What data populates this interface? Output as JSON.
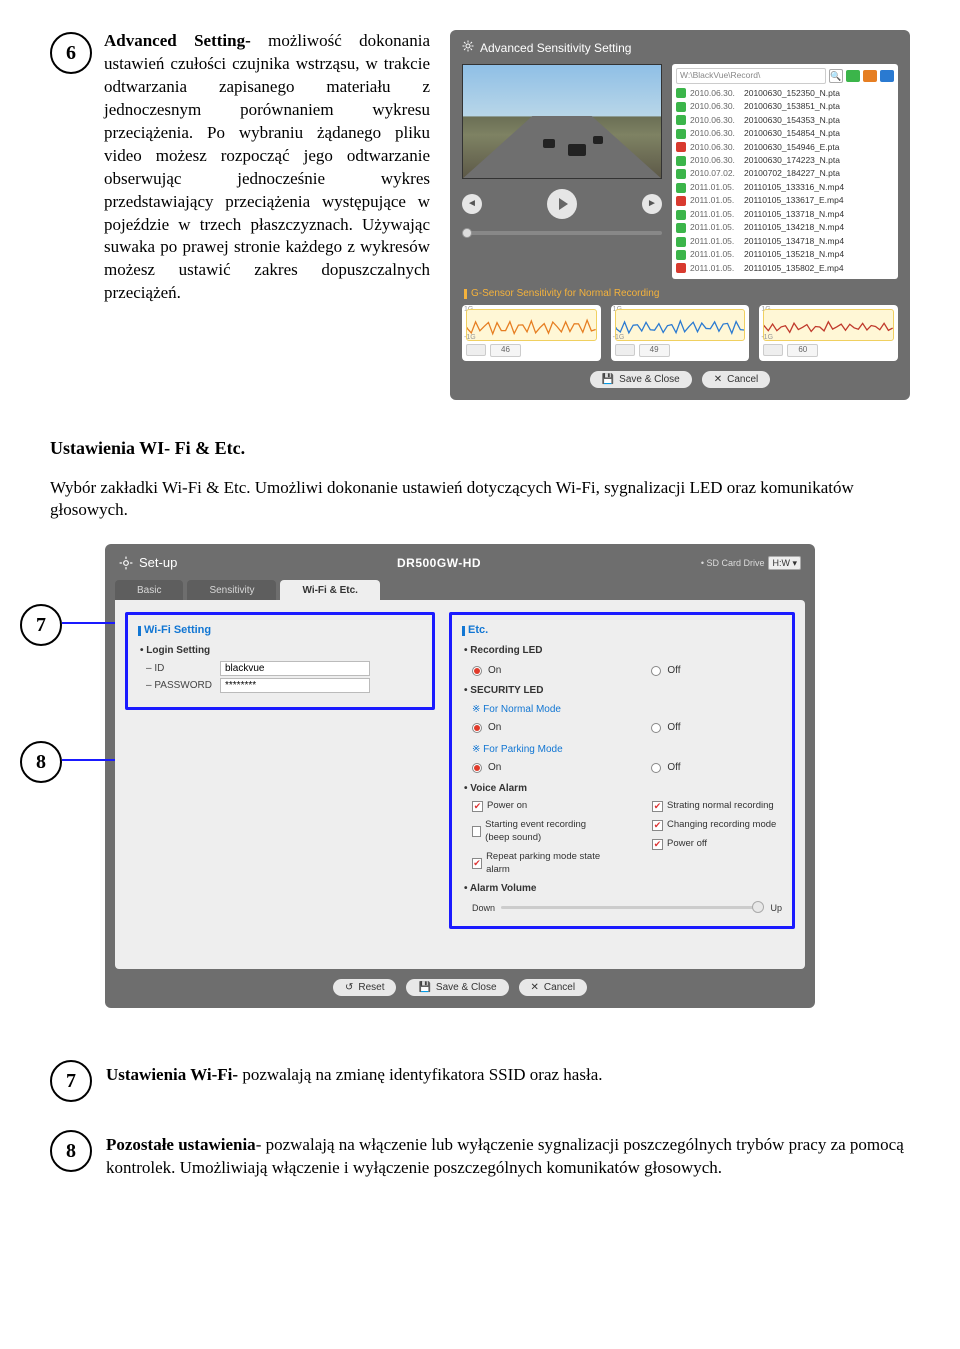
{
  "item6": {
    "num": "6",
    "text": "Advanced Setting- możliwość dokonania ustawień czułości czujnika wstrząsu, w trakcie odtwarzania zapisanego materiału z jednoczesnym porównaniem wykresu przeciążenia. Po wybraniu żądanego pliku video możesz rozpocząć jego odtwarzanie obserwując jednocześnie wykres przedstawiający przeciążenia występujące w pojeździe w trzech płaszczyznach. Używając suwaka po prawej stronie każdego z wykresów możesz ustawić zakres dopuszczalnych przeciążeń.",
    "bold_lead": "Advanced Setting-"
  },
  "sens_panel": {
    "title": "Advanced Sensitivity Setting",
    "files_path": "W:\\BlackVue\\Record\\",
    "files": [
      {
        "date": "2010.06.30.",
        "name": "20100630_152350_N.pta",
        "c": "#3bb54a"
      },
      {
        "date": "2010.06.30.",
        "name": "20100630_153851_N.pta",
        "c": "#3bb54a"
      },
      {
        "date": "2010.06.30.",
        "name": "20100630_154353_N.pta",
        "c": "#3bb54a"
      },
      {
        "date": "2010.06.30.",
        "name": "20100630_154854_N.pta",
        "c": "#3bb54a"
      },
      {
        "date": "2010.06.30.",
        "name": "20100630_154946_E.pta",
        "c": "#d83a2f"
      },
      {
        "date": "2010.06.30.",
        "name": "20100630_174223_N.pta",
        "c": "#3bb54a"
      },
      {
        "date": "2010.07.02.",
        "name": "20100702_184227_N.pta",
        "c": "#3bb54a"
      },
      {
        "date": "2011.01.05.",
        "name": "20110105_133316_N.mp4",
        "c": "#3bb54a"
      },
      {
        "date": "2011.01.05.",
        "name": "20110105_133617_E.mp4",
        "c": "#d83a2f"
      },
      {
        "date": "2011.01.05.",
        "name": "20110105_133718_N.mp4",
        "c": "#3bb54a"
      },
      {
        "date": "2011.01.05.",
        "name": "20110105_134218_N.mp4",
        "c": "#3bb54a"
      },
      {
        "date": "2011.01.05.",
        "name": "20110105_134718_N.mp4",
        "c": "#3bb54a"
      },
      {
        "date": "2011.01.05.",
        "name": "20110105_135218_N.mp4",
        "c": "#3bb54a"
      },
      {
        "date": "2011.01.05.",
        "name": "20110105_135802_E.mp4",
        "c": "#d83a2f"
      }
    ],
    "sens_label": "G-Sensor Sensitivity for Normal Recording",
    "scale_top": "1G",
    "scale_bot": "-1G",
    "waves": [
      {
        "val": "46"
      },
      {
        "val": "49"
      },
      {
        "val": "60"
      }
    ],
    "save_close": "Save & Close",
    "cancel": "Cancel"
  },
  "section_title": "Ustawienia WI- Fi & Etc.",
  "section_para": "Wybór zakładki Wi-Fi & Etc. Umożliwi dokonanie ustawień dotyczących Wi-Fi, sygnalizacji LED oraz komunikatów głosowych.",
  "setup": {
    "title": "Set-up",
    "model": "DR500GW-HD",
    "drive_label": "• SD Card Drive",
    "drive_value": "H:W ▾",
    "tabs": {
      "basic": "Basic",
      "sens": "Sensitivity",
      "wifi": "Wi-Fi & Etc."
    },
    "left_box": {
      "title": "Wi-Fi Setting",
      "login": "• Login Setting",
      "id_label": "– ID",
      "id_value": "blackvue",
      "pw_label": "– PASSWORD",
      "pw_value": "********"
    },
    "right_box": {
      "title": "Etc.",
      "rec_led": "• Recording LED",
      "on": "On",
      "off": "Off",
      "sec_led": "• SECURITY LED",
      "normal_mode": "※ For Normal Mode",
      "parking_mode": "※ For Parking Mode",
      "voice_alarm": "• Voice Alarm",
      "chk_poweron": "Power on",
      "chk_startnormal": "Strating normal recording",
      "chk_startevent": "Starting event recording (beep sound)",
      "chk_changemode": "Changing recording mode",
      "chk_repeatpark": "Repeat parking mode state alarm",
      "chk_poweroff": "Power off",
      "alarm_vol": "• Alarm Volume",
      "down": "Down",
      "up": "Up"
    },
    "reset": "Reset",
    "save_close": "Save & Close",
    "cancel": "Cancel"
  },
  "badge7": "7",
  "badge8": "8",
  "item7": {
    "bold": "Ustawienia Wi-Fi-",
    "rest": " pozwalają na zmianę identyfikatora SSID oraz hasła."
  },
  "item8": {
    "bold": "Pozostałe ustawienia",
    "rest": "- pozwalają na włączenie lub wyłączenie sygnalizacji poszczególnych trybów pracy za pomocą kontrolek. Umożliwiają włączenie i wyłączenie poszczególnych komunikatów głosowych."
  },
  "icons": {
    "save": "💾",
    "cancel": "✕",
    "reset": "↺",
    "search": "🔍",
    "prev": "◄",
    "next": "►"
  }
}
